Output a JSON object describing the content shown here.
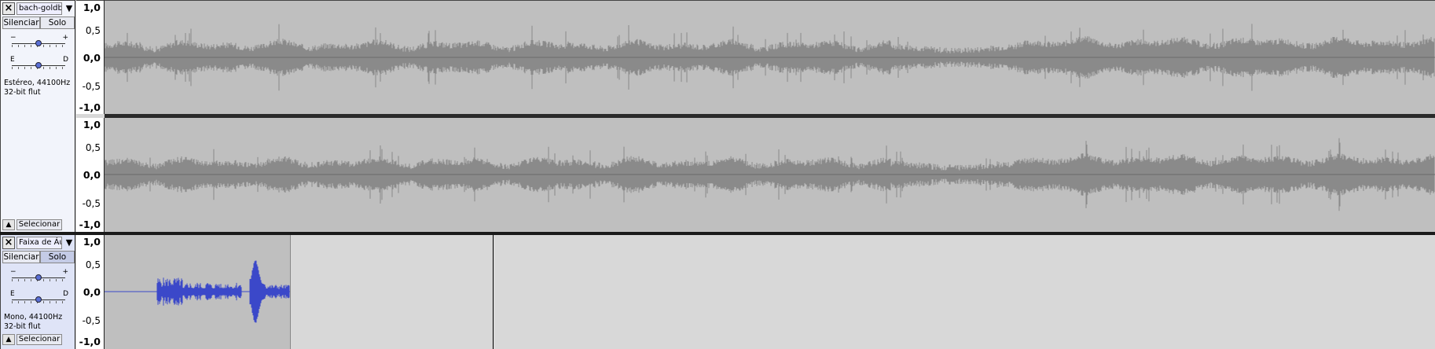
{
  "tracks": [
    {
      "name": "bach-goldberg",
      "mute_label": "Silenciar",
      "solo_label": "Solo",
      "gain_minus": "−",
      "gain_plus": "+",
      "pan_left": "E",
      "pan_right": "D",
      "info_line1": "Estéreo, 44100Hz",
      "info_line2": "32-bit flut",
      "select_label": "Selecionar",
      "channels": [
        {
          "scale": [
            "1,0",
            "0,5",
            "0,0",
            "-0,5",
            "-1,0"
          ]
        },
        {
          "scale": [
            "1,0",
            "0,5",
            "0,0",
            "-0,5",
            "-1,0"
          ]
        }
      ]
    },
    {
      "name": "Faixa de Áudio",
      "mute_label": "Silenciar",
      "solo_label": "Solo",
      "gain_minus": "−",
      "gain_plus": "+",
      "pan_left": "E",
      "pan_right": "D",
      "info_line1": "Mono, 44100Hz",
      "info_line2": "32-bit flut",
      "select_label": "Selecionar",
      "channels": [
        {
          "scale": [
            "1,0",
            "0,5",
            "0,0",
            "-0,5",
            "-1,0"
          ]
        }
      ]
    }
  ],
  "icons": {
    "close": "×",
    "menu": "▼",
    "collapse": "▲"
  },
  "colors": {
    "stereo_wave": "#8a8a8a",
    "mono_wave": "#3b48c9",
    "clip_bg": "#bfbfbf",
    "empty_bg": "#d8d8d8"
  }
}
